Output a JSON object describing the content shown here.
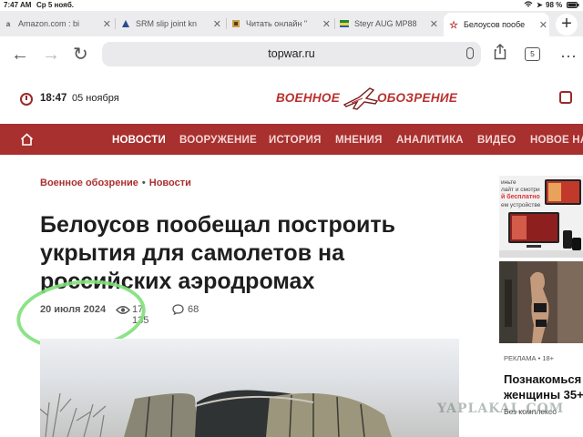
{
  "statusbar": {
    "time": "7:47 AM",
    "date": "Ср 5 нояб.",
    "battery": "98 %"
  },
  "tabs": [
    {
      "label": "Amazon.com : bi",
      "favicon": "a",
      "active": false
    },
    {
      "label": "SRM slip joint kn",
      "favicon": "triangle",
      "active": false
    },
    {
      "label": "Читать онлайн \"",
      "favicon": "book",
      "active": false
    },
    {
      "label": "Steyr AUG MP88",
      "favicon": "flag",
      "active": false
    },
    {
      "label": "Белоусов пообе",
      "favicon": "star",
      "active": true
    }
  ],
  "toolbar": {
    "url": "topwar.ru",
    "tab_count": "5"
  },
  "site": {
    "time": "18:47",
    "date": "05 ноября",
    "logo_word1": "ВОЕННОЕ",
    "logo_word2": "ОБОЗРЕНИЕ"
  },
  "menu": [
    "НОВОСТИ",
    "ВООРУЖЕНИЕ",
    "ИСТОРИЯ",
    "МНЕНИЯ",
    "АНАЛИТИКА",
    "ВИДЕО",
    "НОВОЕ НА"
  ],
  "article": {
    "breadcrumb_1": "Военное обозрение",
    "breadcrumb_2": "Новости",
    "title": "Белоусов пообещал построить укрытия для самолетов на российских аэродромах",
    "date": "20 июля 2024",
    "views": "17 135",
    "comments": "68"
  },
  "sidebar_ad": {
    "promo_text": "иньте\nлайт и смотри",
    "promo_red": "й бесплатно",
    "promo_text2": "ем устройстве",
    "label": "РЕКЛАМА • 18+",
    "headline_1": "Познакомься",
    "headline_2": "женщины 35+",
    "sub": "Без комплексо"
  },
  "watermark": "YAPLAKAL.COM",
  "colors": {
    "brand_red": "#a8302e",
    "highlight_green": "#7fe07a"
  }
}
